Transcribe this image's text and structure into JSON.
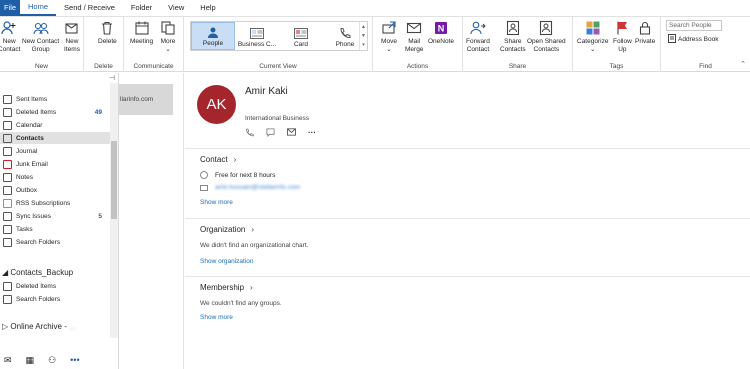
{
  "menu": {
    "file": "File",
    "tabs": [
      "Home",
      "Send / Receive",
      "Folder",
      "View",
      "Help"
    ],
    "active": "Home"
  },
  "ribbon": {
    "new_group": {
      "label": "New",
      "new_contact": [
        "New",
        "Contact"
      ],
      "new_contact_group": [
        "New Contact",
        "Group"
      ],
      "new_items": [
        "New",
        "Items"
      ]
    },
    "delete_group": {
      "label": "Delete",
      "delete": "Delete"
    },
    "communicate_group": {
      "label": "Communicate",
      "meeting": "Meeting",
      "more": "More"
    },
    "current_view_group": {
      "label": "Current View",
      "views": [
        "People",
        "Business C...",
        "Card",
        "Phone"
      ],
      "selected": "People"
    },
    "actions_group": {
      "label": "Actions",
      "move": "Move",
      "mail_merge": [
        "Mail",
        "Merge"
      ],
      "onenote": "OneNote"
    },
    "share_group": {
      "label": "Share",
      "forward_contact": [
        "Forward",
        "Contact"
      ],
      "share_contacts": [
        "Share",
        "Contacts"
      ],
      "open_shared_contacts": [
        "Open Shared",
        "Contacts"
      ]
    },
    "tags_group": {
      "label": "Tags",
      "categorize": "Categorize",
      "follow_up": [
        "Follow",
        "Up"
      ],
      "private": "Private"
    },
    "find_group": {
      "label": "Find",
      "search_people_placeholder": "Search People",
      "address_book": "Address Book"
    }
  },
  "folders": {
    "items": [
      {
        "label": "Sent Items",
        "count": ""
      },
      {
        "label": "Deleted Items",
        "count": "49"
      },
      {
        "label": "Calendar",
        "count": ""
      },
      {
        "label": "Contacts",
        "count": "",
        "selected": true
      },
      {
        "label": "Journal",
        "count": ""
      },
      {
        "label": "Junk Email",
        "count": ""
      },
      {
        "label": "Notes",
        "count": ""
      },
      {
        "label": "Outbox",
        "count": ""
      },
      {
        "label": "RSS Subscriptions",
        "count": ""
      },
      {
        "label": "Sync Issues",
        "count": "5"
      },
      {
        "label": "Tasks",
        "count": ""
      },
      {
        "label": "Search Folders",
        "count": ""
      }
    ],
    "backup_header": "Contacts_Backup",
    "backup_items": [
      "Deleted Items",
      "Search Folders"
    ],
    "archive_header": "Online Archive -",
    "archive_suffix": "..."
  },
  "contact_list": {
    "card_text": "llarinfo.com"
  },
  "contact": {
    "initials": "AK",
    "name": "Amir Kaki",
    "company": "International Business",
    "contact_section": "Contact",
    "availability": "Free for next 8 hours",
    "email": "amir.hussain@stellarinfo.com",
    "show_more": "Show more",
    "organization_section": "Organization",
    "organization_msg": "We didn't find an organizational chart.",
    "show_organization": "Show organization",
    "membership_section": "Membership",
    "membership_msg": "We couldn't find any groups.",
    "show_more_2": "Show more"
  },
  "colors": {
    "accent": "#1e5fa8",
    "avatar": "#a4262c",
    "selected_view": "#c9def5"
  }
}
